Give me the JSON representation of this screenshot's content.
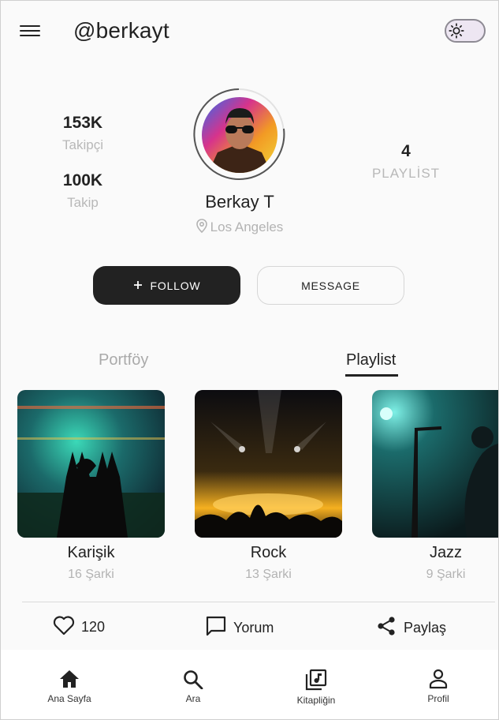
{
  "header": {
    "handle": "@berkayt",
    "menu_icon": "hamburger-menu-icon",
    "theme_icon": "sun-icon"
  },
  "profile": {
    "followers_count": "153K",
    "followers_label": "Takipçi",
    "following_count": "100K",
    "following_label": "Takip",
    "playlists_count": "4",
    "playlists_label": "PLAYLİST",
    "name": "Berkay T",
    "location": "Los Angeles"
  },
  "actions": {
    "follow_label": "FOLLOW",
    "follow_icon": "plus-icon",
    "message_label": "MESSAGE"
  },
  "tabs": [
    {
      "label": "Portföy",
      "active": false
    },
    {
      "label": "Playlist",
      "active": true
    }
  ],
  "playlists": [
    {
      "title": "Karişik",
      "count": "16 Şarki"
    },
    {
      "title": "Rock",
      "count": "13 Şarki"
    },
    {
      "title": "Jazz",
      "count": "9 Şarki"
    }
  ],
  "engagement": {
    "likes": "120",
    "comment_label": "Yorum",
    "share_label": "Paylaş"
  },
  "bottom_nav": [
    {
      "label": "Ana Sayfa",
      "icon": "home-icon"
    },
    {
      "label": "Ara",
      "icon": "search-icon"
    },
    {
      "label": "Kitapliğin",
      "icon": "library-music-icon"
    },
    {
      "label": "Profil",
      "icon": "profile-icon"
    }
  ],
  "colors": {
    "primary_dark": "#222222",
    "muted_text": "#b3b3b3",
    "toggle_bg": "#ede6f2"
  }
}
